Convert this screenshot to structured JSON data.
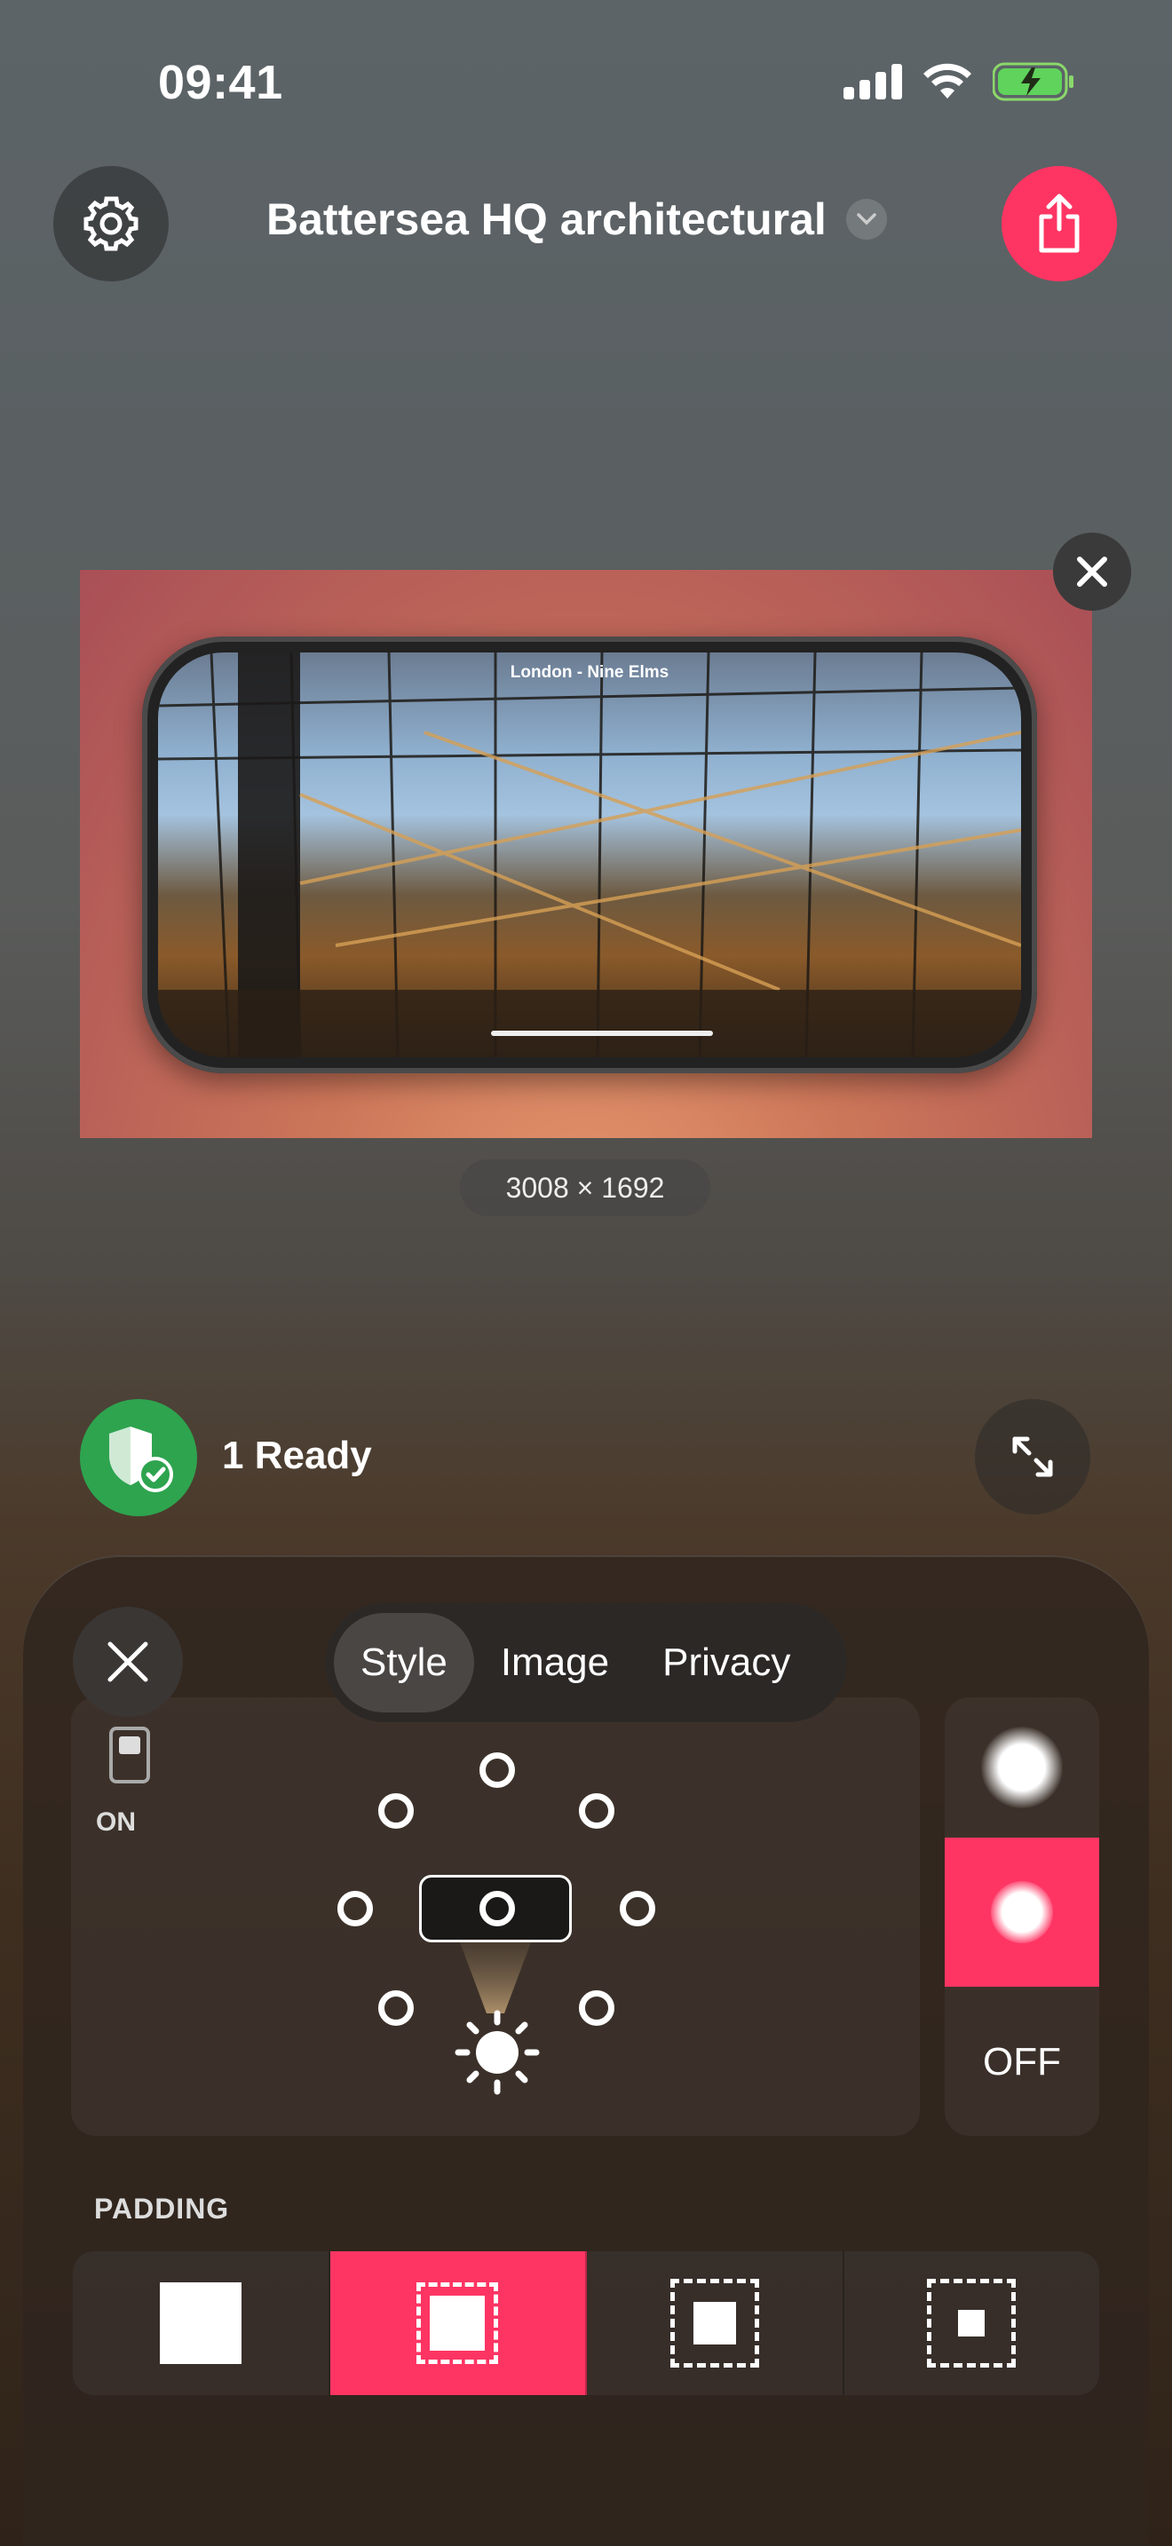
{
  "status_bar": {
    "time": "09:41"
  },
  "header": {
    "title": "Battersea HQ architectural",
    "settings_icon": "gear-icon",
    "share_icon": "share-icon",
    "share_color": "#fe3563"
  },
  "preview": {
    "screenshot_title": "London - Nine Elms",
    "dimensions": "3008 × 1692"
  },
  "ready": {
    "label": "1 Ready",
    "badge_color": "#2ea44f"
  },
  "panel": {
    "tabs": [
      "Style",
      "Image",
      "Privacy"
    ],
    "active_tab": "Style",
    "toggle_label": "ON",
    "shadow_off_label": "OFF",
    "padding_label": "PADDING",
    "padding_options": [
      "none",
      "small",
      "medium",
      "large"
    ],
    "padding_selected_index": 1,
    "accent": "#fe3563"
  }
}
